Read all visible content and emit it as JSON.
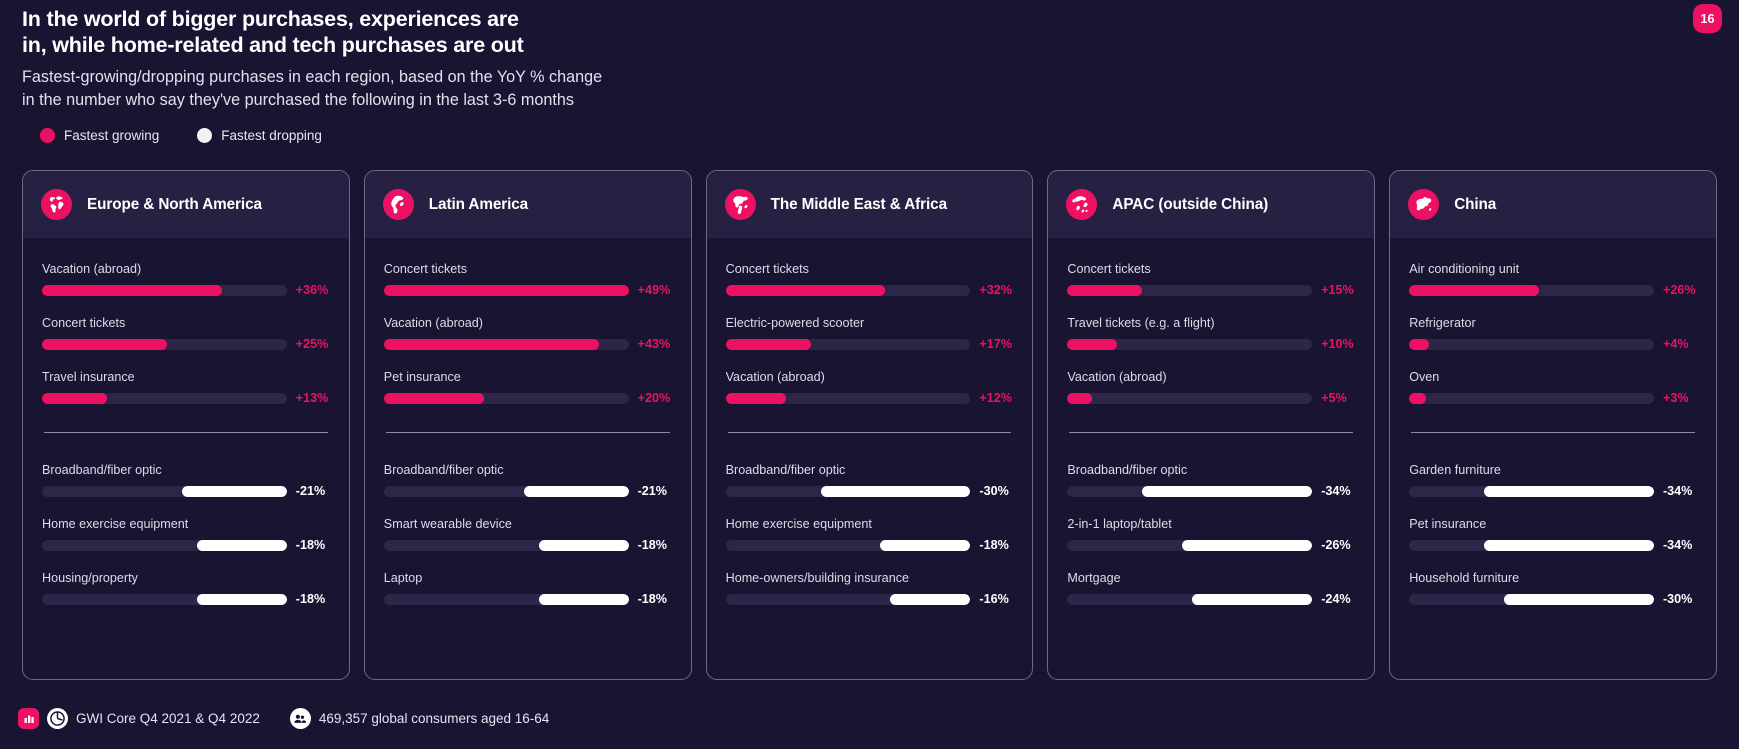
{
  "page_badge": "16",
  "header": {
    "title": "In the world of bigger purchases, experiences are\nin, while home-related and tech purchases are out",
    "subtitle": "Fastest-growing/dropping purchases in each region, based on the YoY % change\nin the number who say they've purchased the following in the last 3-6 months"
  },
  "legend": {
    "growing_label": "Fastest growing",
    "dropping_label": "Fastest dropping",
    "growing_color": "#ed1164",
    "dropping_color": "#f2f2f2"
  },
  "footer": {
    "source_text": "GWI Core Q4 2021 & Q4 2022",
    "audience_text": "469,357 global consumers aged 16-64"
  },
  "chart_data": {
    "type": "bar",
    "title": "In the world of bigger purchases, experiences are in, while home-related and tech purchases are out",
    "subtitle": "Fastest-growing/dropping purchases in each region, based on the YoY % change in the number who say they've purchased the following in the last 3-6 months",
    "xlabel": "YoY % change",
    "ylabel": "",
    "value_unit": "%",
    "scale_max_abs": 49,
    "legend": [
      "Fastest growing",
      "Fastest dropping"
    ],
    "legend_position": "top-left",
    "grid": false,
    "panels": [
      {
        "region": "Europe & North America",
        "icon": "globe-europe-icon",
        "growing": [
          {
            "label": "Vacation (abroad)",
            "value": 36,
            "display": "+36%"
          },
          {
            "label": "Concert tickets",
            "value": 25,
            "display": "+25%"
          },
          {
            "label": "Travel insurance",
            "value": 13,
            "display": "+13%"
          }
        ],
        "dropping": [
          {
            "label": "Broadband/fiber optic",
            "value": -21,
            "display": "-21%"
          },
          {
            "label": "Home exercise equipment",
            "value": -18,
            "display": "-18%"
          },
          {
            "label": "Housing/property",
            "value": -18,
            "display": "-18%"
          }
        ]
      },
      {
        "region": "Latin America",
        "icon": "globe-south-america-icon",
        "growing": [
          {
            "label": "Concert tickets",
            "value": 49,
            "display": "+49%"
          },
          {
            "label": "Vacation (abroad)",
            "value": 43,
            "display": "+43%"
          },
          {
            "label": "Pet insurance",
            "value": 20,
            "display": "+20%"
          }
        ],
        "dropping": [
          {
            "label": "Broadband/fiber optic",
            "value": -21,
            "display": "-21%"
          },
          {
            "label": "Smart wearable device",
            "value": -18,
            "display": "-18%"
          },
          {
            "label": "Laptop",
            "value": -18,
            "display": "-18%"
          }
        ]
      },
      {
        "region": "The Middle East & Africa",
        "icon": "globe-africa-icon",
        "growing": [
          {
            "label": "Concert tickets",
            "value": 32,
            "display": "+32%"
          },
          {
            "label": "Electric-powered scooter",
            "value": 17,
            "display": "+17%"
          },
          {
            "label": "Vacation (abroad)",
            "value": 12,
            "display": "+12%"
          }
        ],
        "dropping": [
          {
            "label": "Broadband/fiber optic",
            "value": -30,
            "display": "-30%"
          },
          {
            "label": "Home exercise equipment",
            "value": -18,
            "display": "-18%"
          },
          {
            "label": "Home-owners/building insurance",
            "value": -16,
            "display": "-16%"
          }
        ]
      },
      {
        "region": "APAC (outside China)",
        "icon": "globe-asia-icon",
        "growing": [
          {
            "label": "Concert tickets",
            "value": 15,
            "display": "+15%"
          },
          {
            "label": "Travel tickets (e.g. a flight)",
            "value": 10,
            "display": "+10%"
          },
          {
            "label": "Vacation (abroad)",
            "value": 5,
            "display": "+5%"
          }
        ],
        "dropping": [
          {
            "label": "Broadband/fiber optic",
            "value": -34,
            "display": "-34%"
          },
          {
            "label": "2-in-1 laptop/tablet",
            "value": -26,
            "display": "-26%"
          },
          {
            "label": "Mortgage",
            "value": -24,
            "display": "-24%"
          }
        ]
      },
      {
        "region": "China",
        "icon": "map-china-icon",
        "growing": [
          {
            "label": "Air conditioning unit",
            "value": 26,
            "display": "+26%"
          },
          {
            "label": "Refrigerator",
            "value": 4,
            "display": "+4%"
          },
          {
            "label": "Oven",
            "value": 3,
            "display": "+3%"
          }
        ],
        "dropping": [
          {
            "label": "Garden furniture",
            "value": -34,
            "display": "-34%"
          },
          {
            "label": "Pet insurance",
            "value": -34,
            "display": "-34%"
          },
          {
            "label": "Household furniture",
            "value": -30,
            "display": "-30%"
          }
        ]
      }
    ]
  }
}
